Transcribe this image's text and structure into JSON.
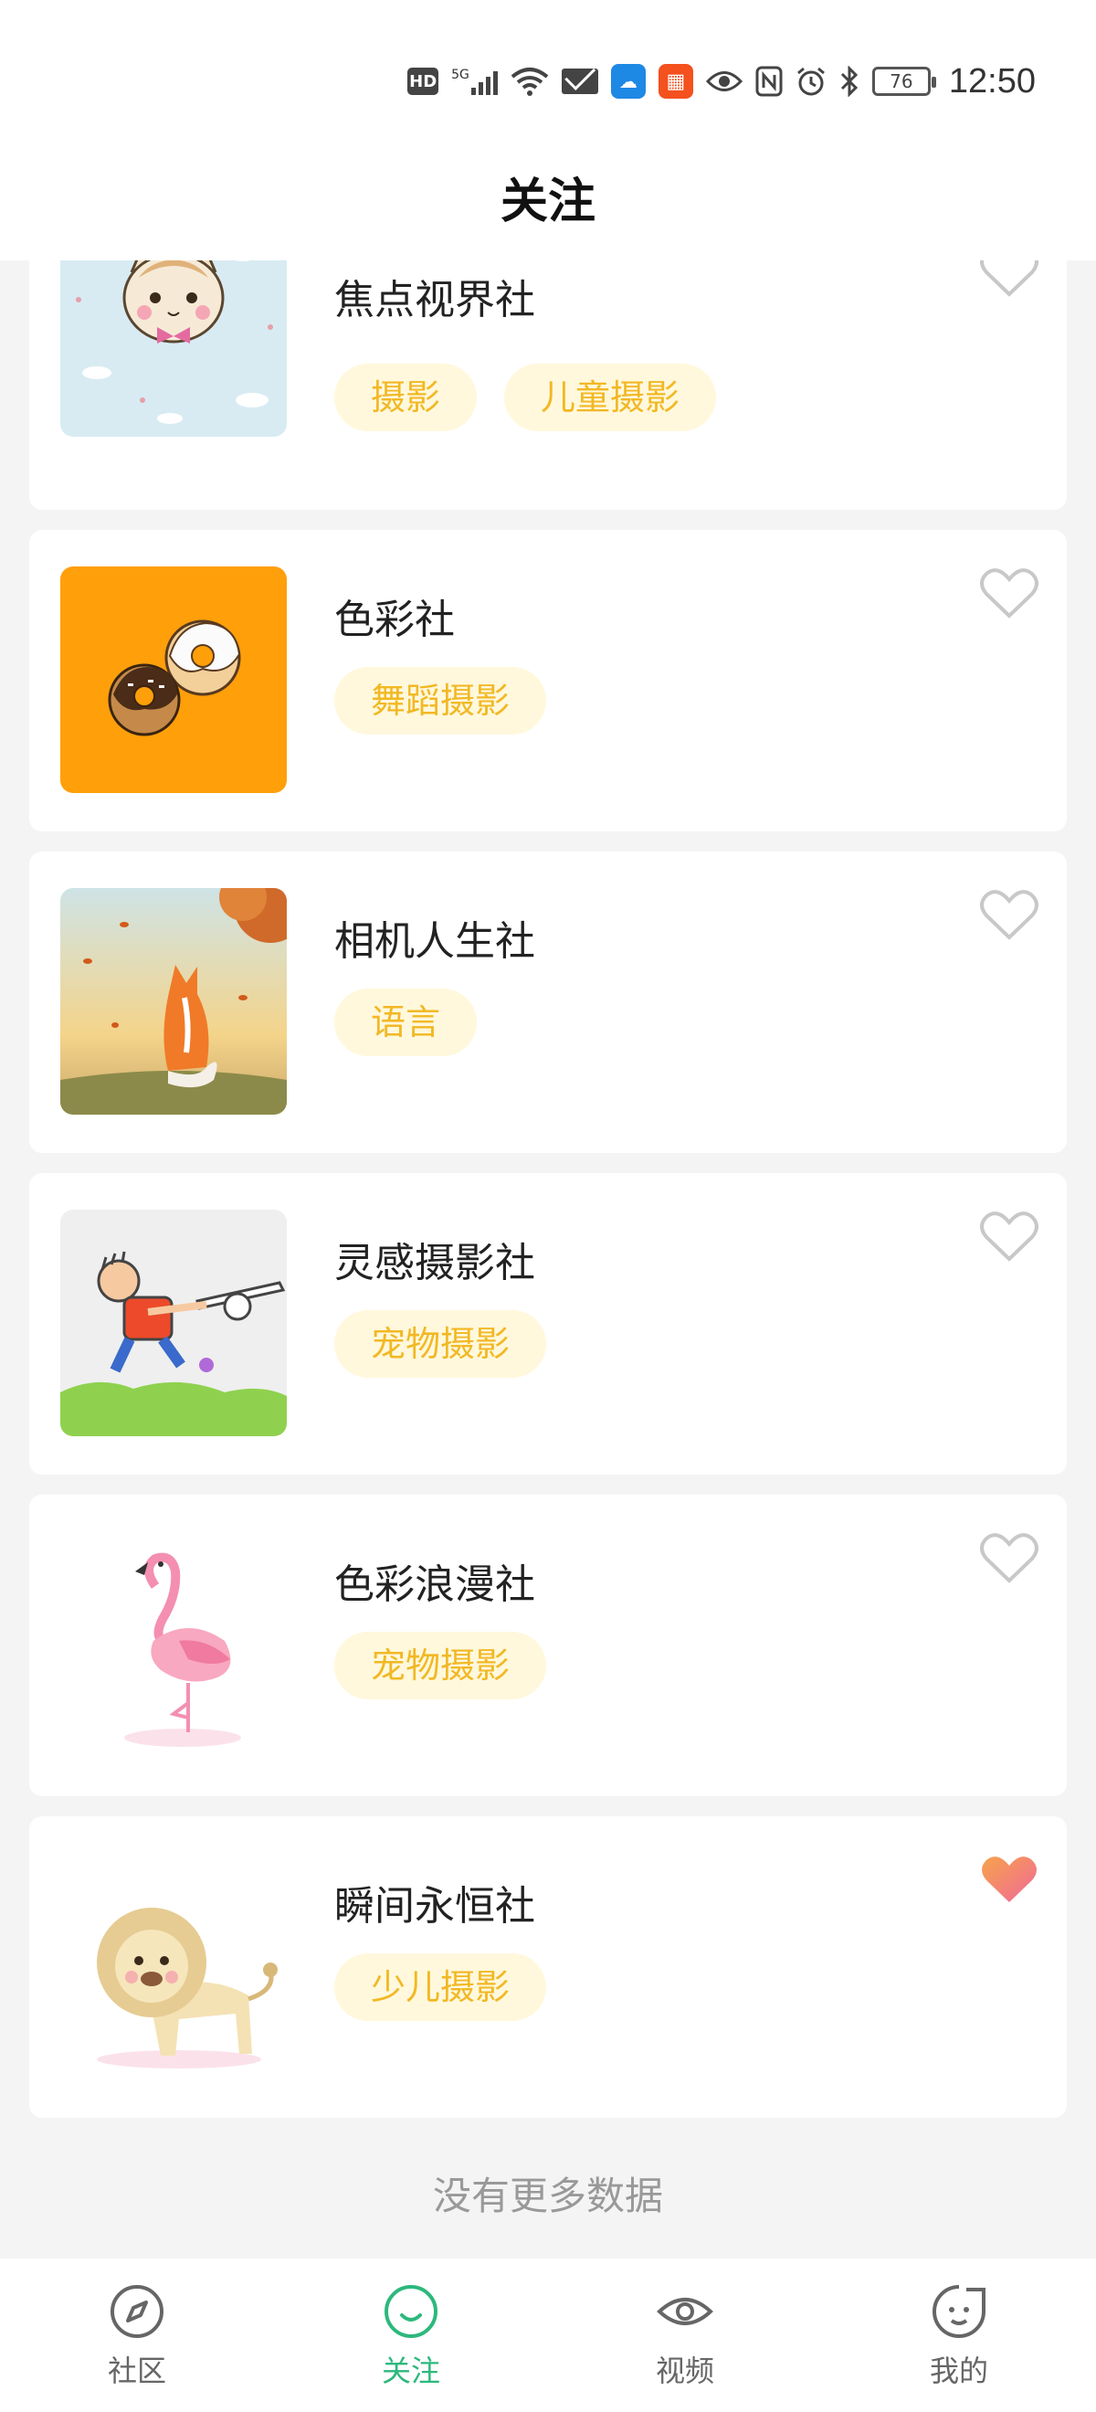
{
  "status_bar": {
    "hd": "HD",
    "network": "5G",
    "battery": "76",
    "time": "12:50"
  },
  "header": {
    "title": "关注"
  },
  "clubs": [
    {
      "name": "焦点视界社",
      "tags": [
        "摄影",
        "儿童摄影"
      ],
      "liked": false,
      "thumb": "kitten-icon"
    },
    {
      "name": "色彩社",
      "tags": [
        "舞蹈摄影"
      ],
      "liked": false,
      "thumb": "donut-icon"
    },
    {
      "name": "相机人生社",
      "tags": [
        "语言"
      ],
      "liked": false,
      "thumb": "fox-icon"
    },
    {
      "name": "灵感摄影社",
      "tags": [
        "宠物摄影"
      ],
      "liked": false,
      "thumb": "kid-icon"
    },
    {
      "name": "色彩浪漫社",
      "tags": [
        "宠物摄影"
      ],
      "liked": false,
      "thumb": "flamingo-icon"
    },
    {
      "name": "瞬间永恒社",
      "tags": [
        "少儿摄影"
      ],
      "liked": true,
      "thumb": "lion-icon"
    }
  ],
  "footer_text": "没有更多数据",
  "tabs": [
    {
      "label": "社区",
      "icon": "compass-icon",
      "active": false
    },
    {
      "label": "关注",
      "icon": "smile-icon",
      "active": true
    },
    {
      "label": "视频",
      "icon": "eye-icon",
      "active": false
    },
    {
      "label": "我的",
      "icon": "face-icon",
      "active": false
    }
  ],
  "colors": {
    "accent": "#2db87d",
    "tag_bg": "#fff8dc",
    "tag_text": "#f2b824",
    "heart_liked": "#f0689a",
    "background": "#f4f4f4"
  }
}
